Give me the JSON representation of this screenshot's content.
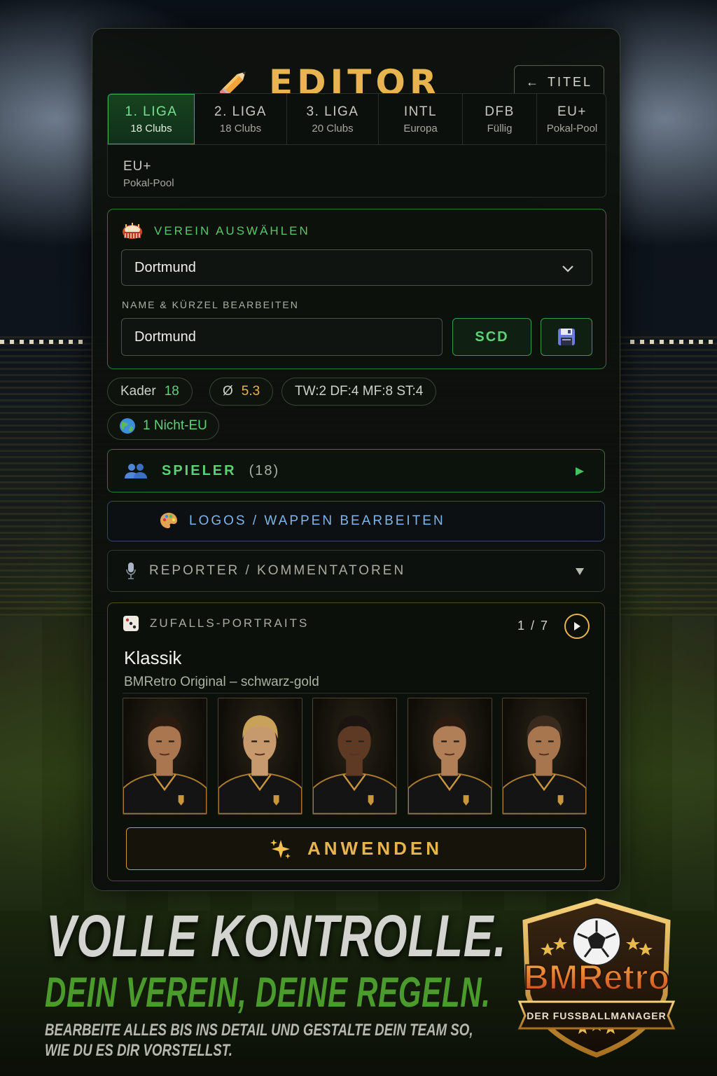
{
  "header": {
    "title": "EDITOR",
    "back_label": "TITEL",
    "back_arrow": "←"
  },
  "league_tabs": [
    {
      "label": "1. LIGA",
      "sub": "18 Clubs",
      "active": true
    },
    {
      "label": "2. LIGA",
      "sub": "18 Clubs"
    },
    {
      "label": "3. LIGA",
      "sub": "20 Clubs"
    },
    {
      "label": "INTL",
      "sub": "Europa"
    },
    {
      "label": "DFB",
      "sub": "Füllig"
    },
    {
      "label": "EU+",
      "sub": "Pokal-Pool"
    },
    {
      "label": "EU+",
      "sub": "Pokal-Pool"
    }
  ],
  "club_section": {
    "title": "VEREIN AUSWÄHLEN",
    "selected_club": "Dortmund",
    "name_label": "NAME & KÜRZEL BEARBEITEN",
    "name_value": "Dortmund",
    "abbreviation": "SCD"
  },
  "stats": {
    "squad_label": "Kader",
    "squad_value": "18",
    "avg_label": "Ø",
    "avg_value": "5.3",
    "positions": "TW:2 DF:4 MF:8 ST:4",
    "non_eu": "1 Nicht-EU"
  },
  "accordions": {
    "players_label": "SPIELER",
    "players_count": "(18)",
    "logos_label": "LOGOS / WAPPEN BEARBEITEN",
    "reporter_label": "REPORTER / KOMMENTATOREN"
  },
  "portraits": {
    "title": "ZUFALLS-PORTRAITS",
    "counter": "1 / 7",
    "preset_name": "Klassik",
    "preset_desc": "BMRetro Original – schwarz-gold",
    "count": 5,
    "apply_label": "ANWENDEN"
  },
  "promo": {
    "headline": "VOLLE KONTROLLE.",
    "subline": "DEIN VEREIN, DEINE REGELN.",
    "body_line1": "BEARBEITE ALLES BIS INS DETAIL UND GESTALTE DEIN TEAM SO,",
    "body_line2": "WIE DU ES DIR VORSTELLST."
  },
  "brand": {
    "name": "BMRetro",
    "tagline": "DER FUSSBALLMANAGER"
  },
  "colors": {
    "accent_gold": "#e7b44f",
    "accent_green": "#57c96b",
    "logo_blue": "#7fb4e8"
  }
}
